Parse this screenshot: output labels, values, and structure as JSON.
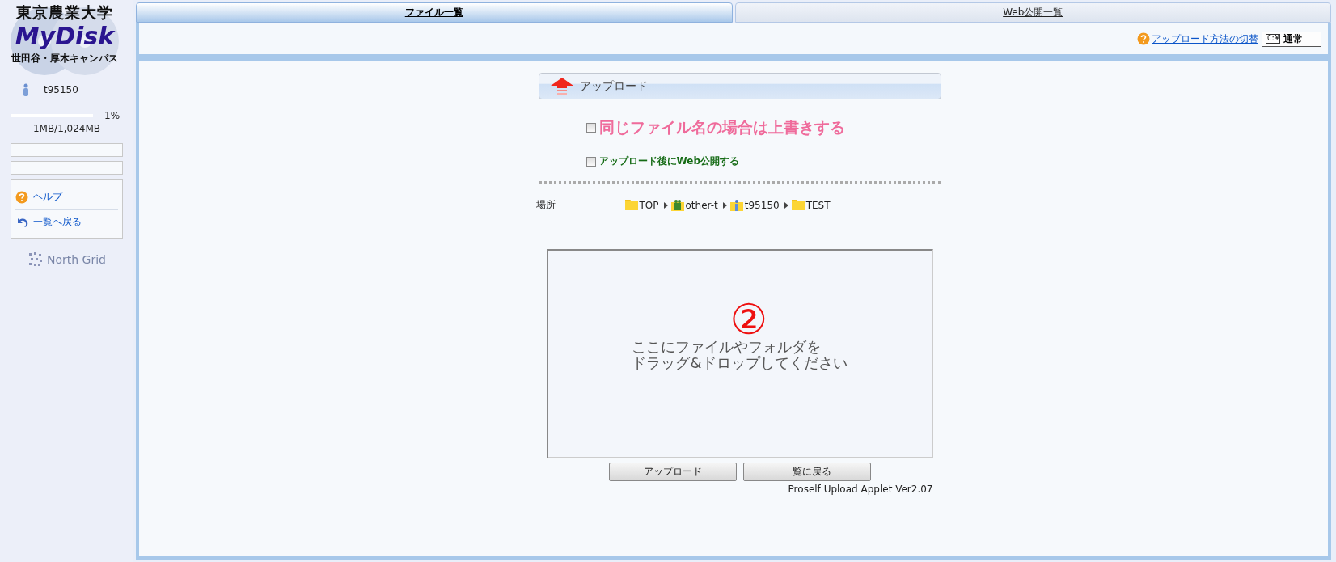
{
  "sidebar": {
    "logo": {
      "title": "東京農業大学",
      "name": "MyDisk",
      "campus": "世田谷・厚木キャンパス"
    },
    "user": "t95150",
    "quota": {
      "level": 0.01,
      "percent": "1%",
      "usage": "1MB/1,024MB"
    },
    "links": [
      {
        "kind": "help",
        "label": "ヘルプ"
      },
      {
        "kind": "back",
        "label": "一覧へ戻る"
      }
    ],
    "footer_logo": "North Grid"
  },
  "tabs": [
    {
      "label": "ファイル一覧",
      "selected": true
    },
    {
      "label": "Web公開一覧",
      "selected": false
    }
  ],
  "toolbar": {
    "switch_link": "アップロード方法の切替",
    "mode_button": {
      "badge": "C:¥",
      "label": "通常"
    }
  },
  "upload": {
    "title": "アップロード",
    "options": [
      {
        "kind": "overwrite",
        "label": "同じファイル名の場合は上書きする",
        "checked": false
      },
      {
        "kind": "publish",
        "label": "アップロード後にWeb公開する",
        "checked": false
      }
    ],
    "location": {
      "label": "場所",
      "path": [
        {
          "kind": "folder",
          "name": "TOP"
        },
        {
          "kind": "group",
          "name": "other-t"
        },
        {
          "kind": "user",
          "name": "t95150"
        },
        {
          "kind": "folder",
          "name": "TEST"
        }
      ]
    },
    "drop_area": {
      "lines": [
        "ここにファイルやフォルダを",
        "ドラッグ&ドロップしてください"
      ],
      "annotation": "②"
    },
    "buttons": [
      "アップロード",
      "一覧に戻る"
    ],
    "version": "Proself Upload Applet Ver2.07"
  }
}
